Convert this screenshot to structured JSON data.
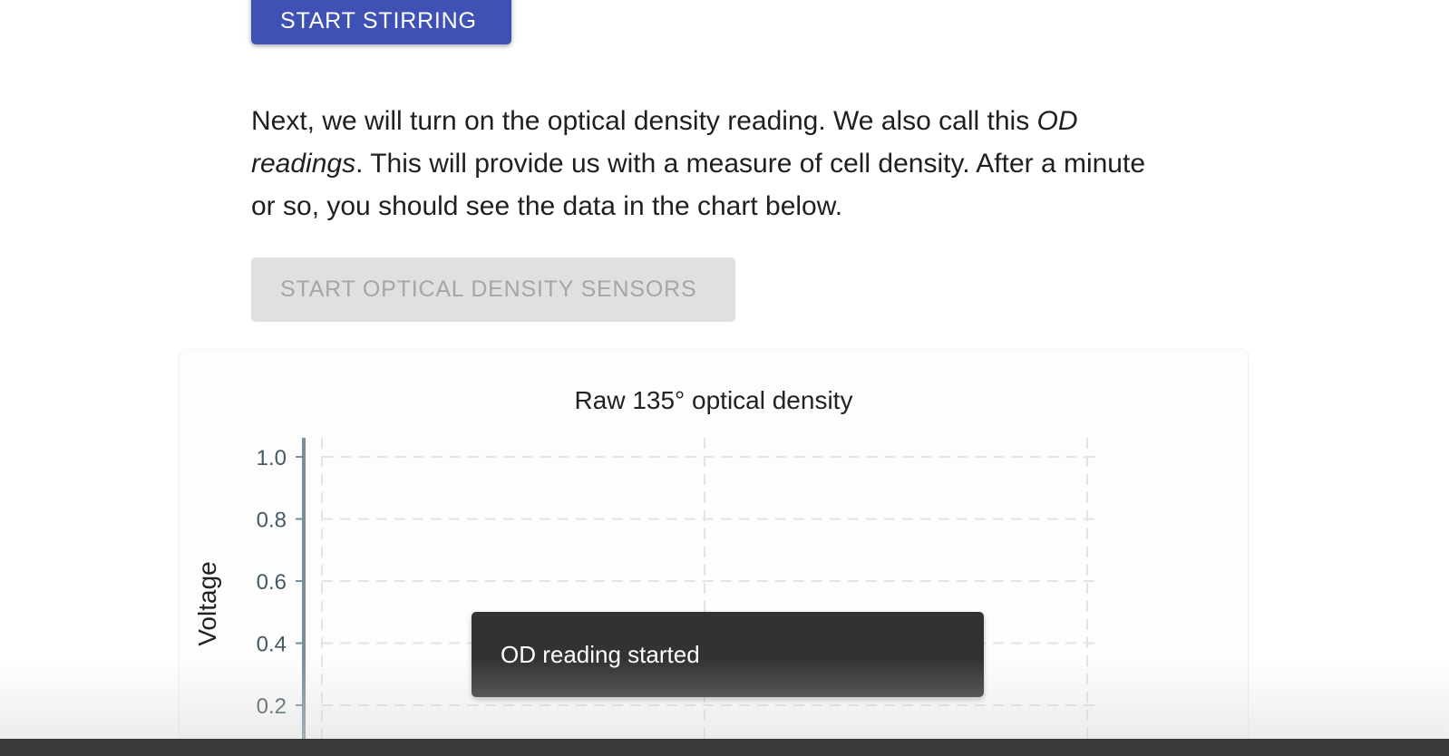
{
  "buttons": {
    "start_stirring": "START STIRRING",
    "start_od_sensors": "START OPTICAL DENSITY SENSORS"
  },
  "instructions": {
    "text_before": "Next, we will turn on the optical density reading. We also call this ",
    "emphasis": "OD readings",
    "text_after": ". This will provide us with a measure of cell density. After a minute or so, you should see the data in the chart below."
  },
  "chart_data": {
    "type": "line",
    "title": "Raw 135° optical density",
    "ylabel": "Voltage",
    "xlabel": "",
    "ylim": [
      0,
      1.0
    ],
    "yticks": [
      "1.0",
      "0.8",
      "0.6",
      "0.4",
      "0.2"
    ],
    "grid": true,
    "series": []
  },
  "snackbar": {
    "message": "OD reading started"
  },
  "colors": {
    "primary": "#3f51b5",
    "disabled_bg": "#e0e0e0",
    "snackbar_bg": "#323232",
    "axis": "#78909c"
  }
}
